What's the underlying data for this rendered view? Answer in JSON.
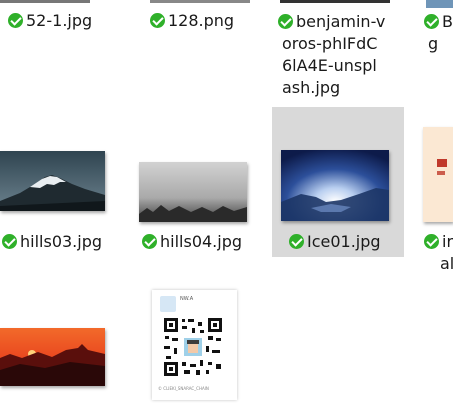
{
  "files": {
    "row1": [
      {
        "name": "52-1.jpg"
      },
      {
        "name": "128.png"
      },
      {
        "name_lines": [
          "benjamin-v",
          "oros-phIFdC",
          "6lA4E-unspl",
          "ash.jpg"
        ]
      },
      {
        "name_lines": [
          "B(",
          "g"
        ]
      }
    ],
    "row2": [
      {
        "name": "hills03.jpg"
      },
      {
        "name": "hills04.jpg"
      },
      {
        "name": "Ice01.jpg"
      },
      {
        "name_lines": [
          "ir",
          "al"
        ]
      }
    ]
  },
  "thumb_texts": {
    "qr_header_title": "NW.A",
    "qr_footer": "© CLIEKI_SNARAC_CHAIN"
  },
  "colors": {
    "selected_bg": "#d9d9d9",
    "check_green": "#2fb02a"
  }
}
